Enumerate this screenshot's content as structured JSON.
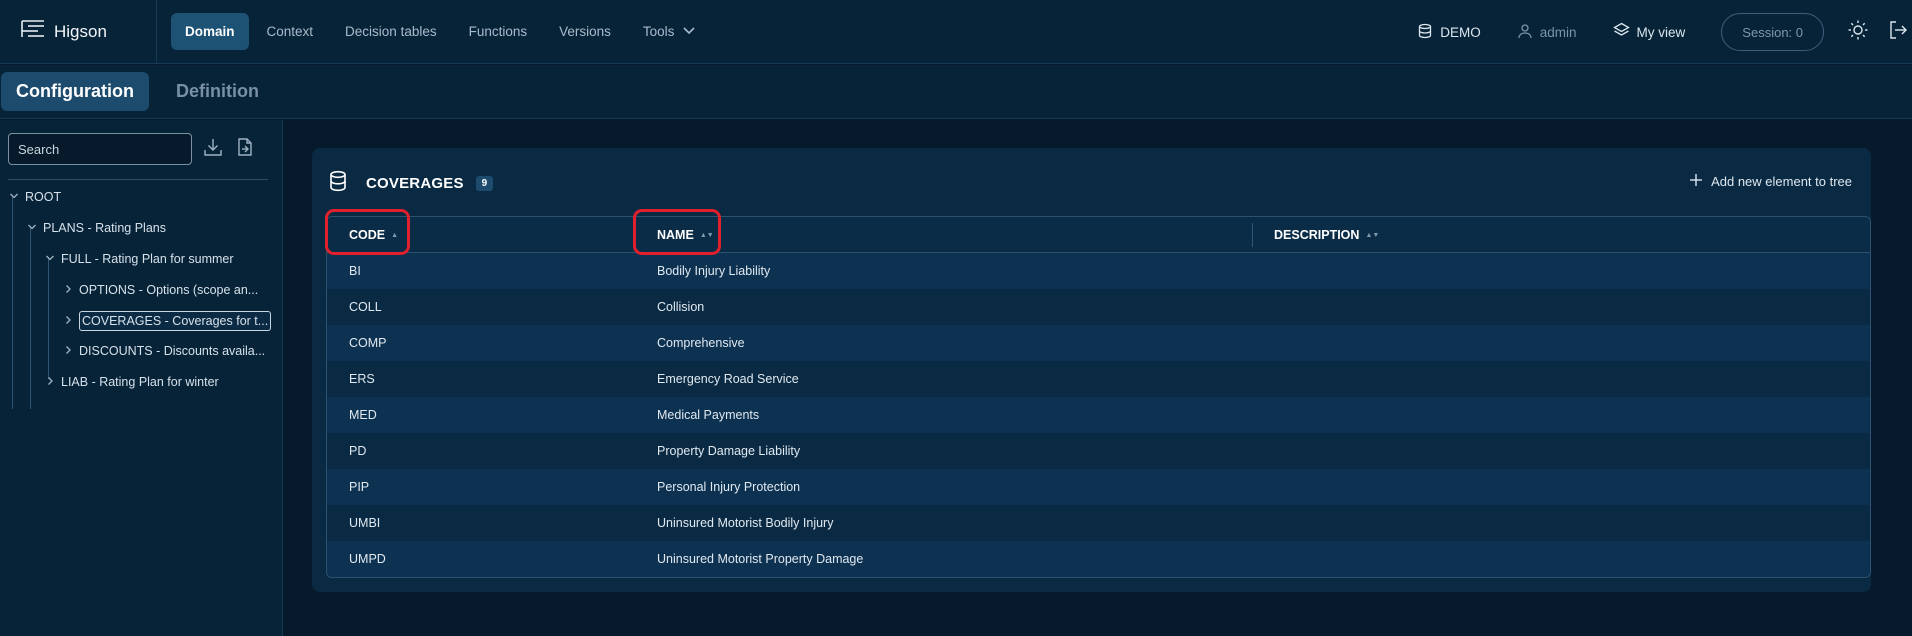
{
  "app": {
    "logo_text": "Higson"
  },
  "nav": {
    "items": [
      {
        "label": "Domain",
        "active": true
      },
      {
        "label": "Context",
        "active": false
      },
      {
        "label": "Decision tables",
        "active": false
      },
      {
        "label": "Functions",
        "active": false
      },
      {
        "label": "Versions",
        "active": false
      },
      {
        "label": "Tools",
        "active": false
      }
    ]
  },
  "top_right": {
    "environment": "DEMO",
    "user": "admin",
    "view": "My view",
    "session": "Session: 0"
  },
  "subtabs": [
    {
      "label": "Configuration",
      "active": true
    },
    {
      "label": "Definition",
      "active": false
    }
  ],
  "sidebar": {
    "search_placeholder": "Search",
    "tree": [
      {
        "label": "ROOT"
      },
      {
        "label": "PLANS - Rating Plans"
      },
      {
        "label": "FULL - Rating Plan for summer"
      },
      {
        "label": "OPTIONS - Options (scope an..."
      },
      {
        "label": "COVERAGES - Coverages for t...",
        "selected": true
      },
      {
        "label": "DISCOUNTS - Discounts availa..."
      },
      {
        "label": "LIAB - Rating Plan for winter"
      }
    ]
  },
  "panel": {
    "title": "COVERAGES",
    "count": "9",
    "add_label": "Add new element to tree",
    "columns": [
      "CODE",
      "NAME",
      "DESCRIPTION"
    ],
    "rows": [
      {
        "code": "BI",
        "name": "Bodily Injury Liability",
        "description": ""
      },
      {
        "code": "COLL",
        "name": "Collision",
        "description": ""
      },
      {
        "code": "COMP",
        "name": "Comprehensive",
        "description": ""
      },
      {
        "code": "ERS",
        "name": "Emergency Road Service",
        "description": ""
      },
      {
        "code": "MED",
        "name": "Medical Payments",
        "description": ""
      },
      {
        "code": "PD",
        "name": "Property Damage Liability",
        "description": ""
      },
      {
        "code": "PIP",
        "name": "Personal Injury Protection",
        "description": ""
      },
      {
        "code": "UMBI",
        "name": "Uninsured Motorist Bodily Injury",
        "description": ""
      },
      {
        "code": "UMPD",
        "name": "Uninsured Motorist Property Damage",
        "description": ""
      }
    ]
  },
  "colors": {
    "background": "#061a2b",
    "accent": "#1e5275",
    "highlight": "#e0202c"
  }
}
